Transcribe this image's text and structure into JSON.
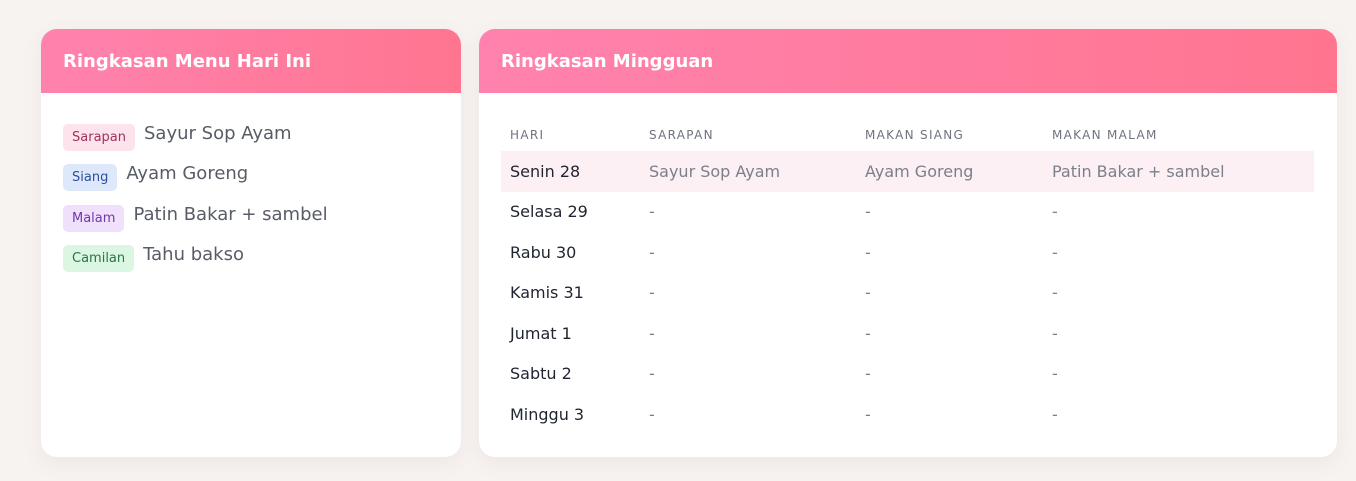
{
  "today": {
    "title": "Ringkasan Menu Hari Ini",
    "items": [
      {
        "tag": "Sarapan",
        "menu": "Sayur Sop Ayam"
      },
      {
        "tag": "Siang",
        "menu": "Ayam Goreng"
      },
      {
        "tag": "Malam",
        "menu": "Patin Bakar + sambel"
      },
      {
        "tag": "Camilan",
        "menu": "Tahu bakso"
      }
    ]
  },
  "weekly": {
    "title": "Ringkasan Mingguan",
    "headers": [
      "HARI",
      "SARAPAN",
      "MAKAN SIANG",
      "MAKAN MALAM"
    ],
    "rows": [
      {
        "day": "Senin 28",
        "sarapan": "Sayur Sop Ayam",
        "siang": "Ayam Goreng",
        "malam": "Patin Bakar + sambel"
      },
      {
        "day": "Selasa 29",
        "sarapan": "-",
        "siang": "-",
        "malam": "-"
      },
      {
        "day": "Rabu 30",
        "sarapan": "-",
        "siang": "-",
        "malam": "-"
      },
      {
        "day": "Kamis 31",
        "sarapan": "-",
        "siang": "-",
        "malam": "-"
      },
      {
        "day": "Jumat 1",
        "sarapan": "-",
        "siang": "-",
        "malam": "-"
      },
      {
        "day": "Sabtu 2",
        "sarapan": "-",
        "siang": "-",
        "malam": "-"
      },
      {
        "day": "Minggu 3",
        "sarapan": "-",
        "siang": "-",
        "malam": "-"
      }
    ]
  },
  "colors": {
    "header_gradient_start": "#ff82ae",
    "header_gradient_end": "#ff7590",
    "highlight_row": "#fdf0f5"
  }
}
